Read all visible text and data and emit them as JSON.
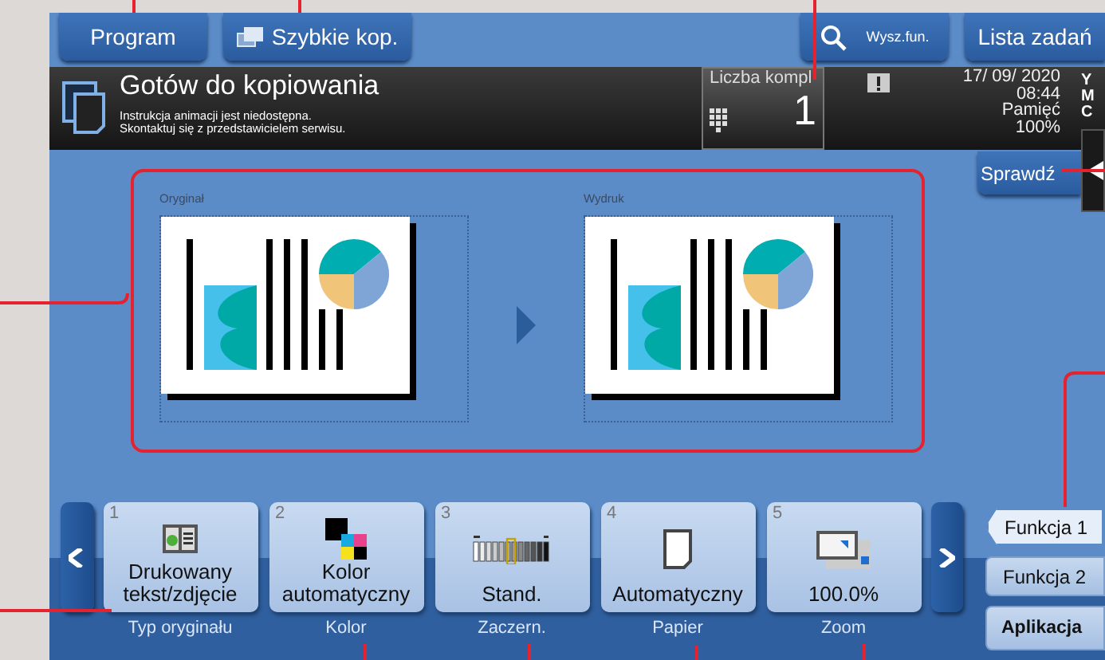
{
  "top_buttons": [
    {
      "label": "Program",
      "kind": "plain"
    },
    {
      "label": "Szybkie kop.",
      "kind": "copy"
    }
  ],
  "top_right_buttons": [
    {
      "label": "Wysz.fun.",
      "kind": "search"
    },
    {
      "label": "Lista zadań",
      "kind": "plain"
    }
  ],
  "status": {
    "title": "Gotów do kopiowania",
    "messages": [
      "Instrukcja animacji jest niedostępna.",
      "Skontaktuj się z przedstawicielem serwisu."
    ],
    "copies_label": "Liczba kompl",
    "copies": "1",
    "date": "17/ 09/ 2020",
    "time": "08:44",
    "memory_label": "Pamięć",
    "memory": "100%",
    "toner": [
      "Y",
      "M",
      "C"
    ]
  },
  "check_button": "Sprawdź",
  "preview": {
    "original_label": "Oryginał",
    "output_label": "Wydruk"
  },
  "function_keys": [
    {
      "number": "1",
      "kind": "original-type",
      "value": "Drukowany tekst/zdjęcie",
      "caption": "Typ oryginału"
    },
    {
      "number": "2",
      "kind": "color",
      "value": "Kolor automatyczny",
      "caption": "Kolor"
    },
    {
      "number": "3",
      "kind": "density",
      "value": "Stand.",
      "caption": "Zaczern."
    },
    {
      "number": "4",
      "kind": "paper",
      "value": "Automatyczny",
      "caption": "Papier"
    },
    {
      "number": "5",
      "kind": "zoom",
      "value": "100.0%",
      "caption": "Zoom"
    }
  ],
  "side_buttons": [
    {
      "label": "Funkcja 1",
      "selected": true
    },
    {
      "label": "Funkcja 2",
      "selected": false
    },
    {
      "label": "Aplikacja",
      "selected": false
    }
  ]
}
